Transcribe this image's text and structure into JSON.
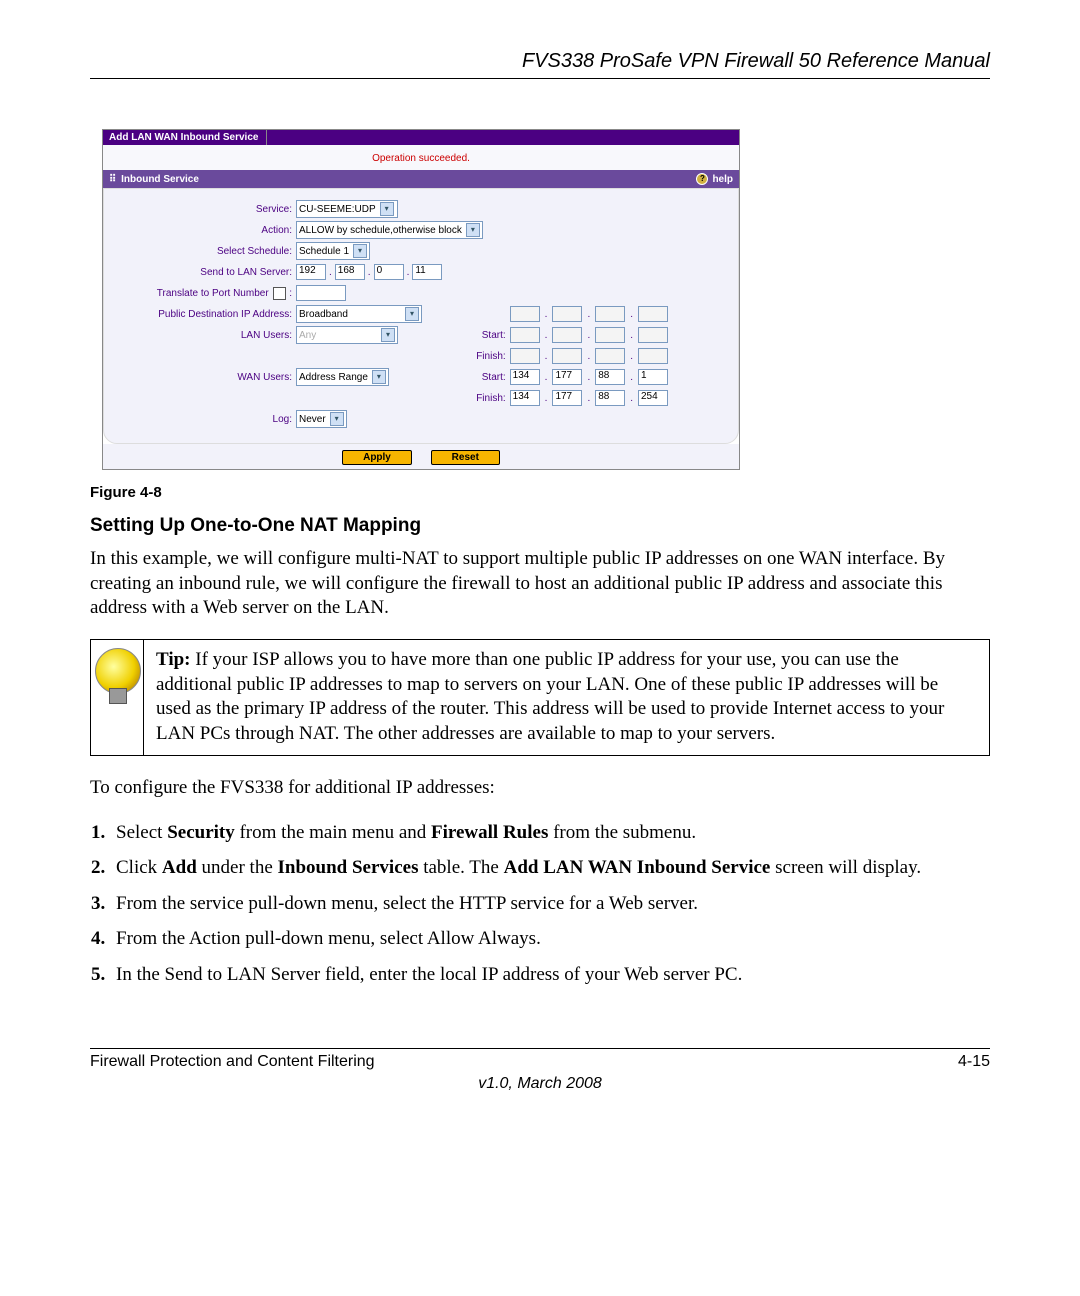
{
  "doc_title": "FVS338 ProSafe VPN Firewall 50 Reference Manual",
  "screenshot": {
    "tab": "Add LAN WAN Inbound Service",
    "status": "Operation succeeded.",
    "section_header": "Inbound Service",
    "help_label": "help",
    "labels": {
      "service": "Service:",
      "action": "Action:",
      "select_schedule": "Select Schedule:",
      "send_to_lan": "Send to LAN Server:",
      "translate_port": "Translate to Port Number",
      "public_dest": "Public Destination IP Address:",
      "lan_users": "LAN Users:",
      "wan_users": "WAN Users:",
      "log": "Log:",
      "start": "Start:",
      "finish": "Finish:"
    },
    "values": {
      "service": "CU-SEEME:UDP",
      "action": "ALLOW by schedule,otherwise block",
      "schedule": "Schedule 1",
      "lan_ip": [
        "192",
        "168",
        "0",
        "11"
      ],
      "translate_port": "",
      "public_dest": "Broadband",
      "lan_users": "Any",
      "wan_users": "Address Range",
      "wan_start": [
        "134",
        "177",
        "88",
        "1"
      ],
      "wan_finish": [
        "134",
        "177",
        "88",
        "254"
      ],
      "log": "Never"
    },
    "buttons": {
      "apply": "Apply",
      "reset": "Reset"
    }
  },
  "figure_label": "Figure 4-8",
  "heading": "Setting Up One-to-One NAT Mapping",
  "para1": "In this example, we will configure multi-NAT to support multiple public IP addresses on one WAN interface.  By creating an inbound rule, we will configure the firewall to host an additional public IP address and associate this address with a Web server on the LAN.",
  "tip": {
    "lead": "Tip:",
    "body": " If your ISP allows you to have more than one public IP address for your use, you can use the additional public IP addresses to map to servers on your LAN. One of these public IP addresses will be used as the primary IP address of the router. This address will be used to provide Internet access to your LAN PCs through NAT. The other addresses are available to map to your servers."
  },
  "para2": "To configure the FVS338 for additional IP addresses:",
  "steps": [
    {
      "pre": "Select ",
      "b1": "Security",
      "mid": " from the main menu and ",
      "b2": "Firewall Rules",
      "post": " from the submenu."
    },
    {
      "pre": "Click ",
      "b1": "Add",
      "mid": " under the ",
      "b2": "Inbound Services",
      "mid2": " table. The ",
      "b3": "Add LAN WAN Inbound Service",
      "post": " screen will display."
    },
    {
      "text": "From the service pull-down menu, select the HTTP service for a Web server."
    },
    {
      "text": "From the Action pull-down menu, select Allow Always."
    },
    {
      "text": "In the Send to LAN Server field, enter the local IP address of your Web server PC."
    }
  ],
  "footer": {
    "left": "Firewall Protection and Content Filtering",
    "right": "4-15",
    "version": "v1.0, March 2008"
  }
}
